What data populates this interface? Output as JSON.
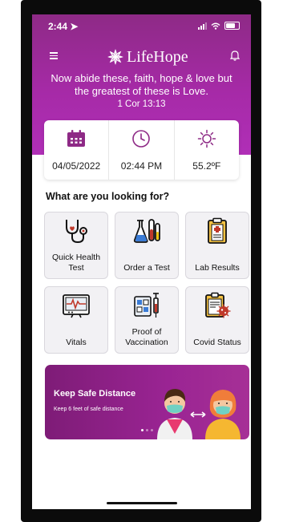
{
  "status_bar": {
    "time": "2:44"
  },
  "app": {
    "name": "LifeHope"
  },
  "verse": {
    "line1": "Now abide these, faith, hope & love but",
    "line2": "the greatest of these is Love.",
    "reference": "1 Cor 13:13"
  },
  "info": {
    "date": "04/05/2022",
    "time": "02:44 PM",
    "temperature": "55.2ºF"
  },
  "section_title": "What are you looking for?",
  "tiles": [
    {
      "label": "Quick Health Test",
      "icon": "stethoscope-icon"
    },
    {
      "label": "Order a Test",
      "icon": "lab-flasks-icon"
    },
    {
      "label": "Lab Results",
      "icon": "clipboard-icon"
    },
    {
      "label": "Vitals",
      "icon": "heart-monitor-icon"
    },
    {
      "label": "Proof of Vaccination",
      "icon": "vaccine-record-icon"
    },
    {
      "label": "Covid Status",
      "icon": "virus-report-icon"
    }
  ],
  "banner": {
    "title": "Keep Safe Distance",
    "subtitle": "Keep 6 feet of safe distance",
    "slides": 3,
    "active_slide": 1
  },
  "colors": {
    "brand_purple": "#a62aa7",
    "tile_bg": "#f2f1f4",
    "icon_red": "#c0392b"
  }
}
